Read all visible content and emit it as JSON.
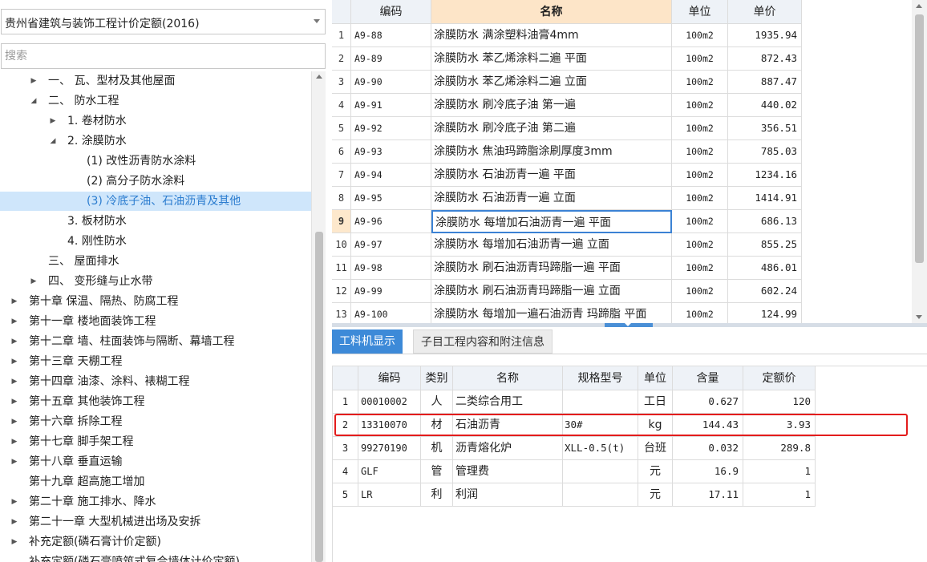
{
  "left_panel": {
    "quota_library": "贵州省建筑与装饰工程计价定额(2016)",
    "search_placeholder": "搜索",
    "tree": [
      {
        "label": "一、 瓦、型材及其他屋面",
        "toggle": "▶",
        "level": 3,
        "selected": false
      },
      {
        "label": "二、 防水工程",
        "toggle": "◢",
        "level": 3,
        "selected": false
      },
      {
        "label": "1. 卷材防水",
        "toggle": "▶",
        "level": 4,
        "selected": false
      },
      {
        "label": "2. 涂膜防水",
        "toggle": "◢",
        "level": 4,
        "selected": false
      },
      {
        "label": "(1) 改性沥青防水涂料",
        "toggle": "",
        "level": 5,
        "selected": false
      },
      {
        "label": "(2) 高分子防水涂料",
        "toggle": "",
        "level": 5,
        "selected": false
      },
      {
        "label": "(3) 冷底子油、石油沥青及其他",
        "toggle": "",
        "level": 5,
        "selected": true
      },
      {
        "label": "3. 板材防水",
        "toggle": "",
        "level": 4,
        "selected": false
      },
      {
        "label": "4. 刚性防水",
        "toggle": "",
        "level": 4,
        "selected": false
      },
      {
        "label": "三、 屋面排水",
        "toggle": "",
        "level": 3,
        "selected": false
      },
      {
        "label": "四、 变形缝与止水带",
        "toggle": "▶",
        "level": 3,
        "selected": false
      },
      {
        "label": "第十章 保温、隔热、防腐工程",
        "toggle": "▶",
        "level": 1,
        "selected": false
      },
      {
        "label": "第十一章 楼地面装饰工程",
        "toggle": "▶",
        "level": 1,
        "selected": false
      },
      {
        "label": "第十二章 墙、柱面装饰与隔断、幕墙工程",
        "toggle": "▶",
        "level": 1,
        "selected": false
      },
      {
        "label": "第十三章 天棚工程",
        "toggle": "▶",
        "level": 1,
        "selected": false
      },
      {
        "label": "第十四章 油漆、涂料、裱糊工程",
        "toggle": "▶",
        "level": 1,
        "selected": false
      },
      {
        "label": "第十五章 其他装饰工程",
        "toggle": "▶",
        "level": 1,
        "selected": false
      },
      {
        "label": "第十六章 拆除工程",
        "toggle": "▶",
        "level": 1,
        "selected": false
      },
      {
        "label": "第十七章 脚手架工程",
        "toggle": "▶",
        "level": 1,
        "selected": false
      },
      {
        "label": "第十八章 垂直运输",
        "toggle": "▶",
        "level": 1,
        "selected": false
      },
      {
        "label": "第十九章 超高施工增加",
        "toggle": "",
        "level": 1,
        "selected": false
      },
      {
        "label": "第二十章 施工排水、降水",
        "toggle": "▶",
        "level": 1,
        "selected": false
      },
      {
        "label": "第二十一章 大型机械进出场及安拆",
        "toggle": "▶",
        "level": 1,
        "selected": false
      },
      {
        "label": "补充定额(磷石膏计价定额)",
        "toggle": "▶",
        "level": 1,
        "selected": false
      },
      {
        "label": "补充定额(磷石膏喷筑式复合墙体计价定额)",
        "toggle": "",
        "level": 1,
        "selected": false
      }
    ]
  },
  "quota_grid": {
    "headers": {
      "code": "编码",
      "name": "名称",
      "unit": "单位",
      "price": "单价"
    },
    "active_row": 9,
    "rows": [
      {
        "no": "1",
        "code": "A9-88",
        "name": "涂膜防水 满涂塑料油膏4mm",
        "unit": "100m2",
        "price": "1935.94"
      },
      {
        "no": "2",
        "code": "A9-89",
        "name": "涂膜防水 苯乙烯涂料二遍 平面",
        "unit": "100m2",
        "price": "872.43"
      },
      {
        "no": "3",
        "code": "A9-90",
        "name": "涂膜防水 苯乙烯涂料二遍 立面",
        "unit": "100m2",
        "price": "887.47"
      },
      {
        "no": "4",
        "code": "A9-91",
        "name": "涂膜防水 刷冷底子油 第一遍",
        "unit": "100m2",
        "price": "440.02"
      },
      {
        "no": "5",
        "code": "A9-92",
        "name": "涂膜防水 刷冷底子油 第二遍",
        "unit": "100m2",
        "price": "356.51"
      },
      {
        "no": "6",
        "code": "A9-93",
        "name": "涂膜防水 焦油玛蹄脂涂刷厚度3mm",
        "unit": "100m2",
        "price": "785.03"
      },
      {
        "no": "7",
        "code": "A9-94",
        "name": "涂膜防水 石油沥青一遍 平面",
        "unit": "100m2",
        "price": "1234.16"
      },
      {
        "no": "8",
        "code": "A9-95",
        "name": "涂膜防水 石油沥青一遍 立面",
        "unit": "100m2",
        "price": "1414.91"
      },
      {
        "no": "9",
        "code": "A9-96",
        "name": "涂膜防水 每增加石油沥青一遍 平面",
        "unit": "100m2",
        "price": "686.13"
      },
      {
        "no": "10",
        "code": "A9-97",
        "name": "涂膜防水 每增加石油沥青一遍 立面",
        "unit": "100m2",
        "price": "855.25"
      },
      {
        "no": "11",
        "code": "A9-98",
        "name": "涂膜防水 刷石油沥青玛蹄脂一遍 平面",
        "unit": "100m2",
        "price": "486.01"
      },
      {
        "no": "12",
        "code": "A9-99",
        "name": "涂膜防水 刷石油沥青玛蹄脂一遍 立面",
        "unit": "100m2",
        "price": "602.24"
      },
      {
        "no": "13",
        "code": "A9-100",
        "name": "涂膜防水 每增加一遍石油沥青 玛蹄脂 平面",
        "unit": "100m2",
        "price": "124.99"
      }
    ]
  },
  "detail_panel": {
    "tabs": [
      {
        "label": "工料机显示",
        "active": true
      },
      {
        "label": "子目工程内容和附注信息",
        "active": false
      }
    ],
    "headers": {
      "code": "编码",
      "category": "类别",
      "name": "名称",
      "spec": "规格型号",
      "unit": "单位",
      "qty": "含量",
      "price": "定额价"
    },
    "rows": [
      {
        "no": "1",
        "code": "00010002",
        "category": "人",
        "name": "二类综合用工",
        "spec": "",
        "unit": "工日",
        "qty": "0.627",
        "price": "120"
      },
      {
        "no": "2",
        "code": "13310070",
        "category": "材",
        "name": "石油沥青",
        "spec": "30#",
        "unit": "kg",
        "qty": "144.43",
        "price": "3.93"
      },
      {
        "no": "3",
        "code": "99270190",
        "category": "机",
        "name": "沥青熔化炉",
        "spec": "XLL-0.5(t)",
        "unit": "台班",
        "qty": "0.032",
        "price": "289.8"
      },
      {
        "no": "4",
        "code": "GLF",
        "category": "管",
        "name": "管理费",
        "spec": "",
        "unit": "元",
        "qty": "16.9",
        "price": "1"
      },
      {
        "no": "5",
        "code": "LR",
        "category": "利",
        "name": "利润",
        "spec": "",
        "unit": "元",
        "qty": "17.11",
        "price": "1"
      }
    ]
  },
  "colors": {
    "selected_tree_bg": "#cfe6fb",
    "selected_tree_text": "#2b7ccf",
    "sorted_header_bg": "#fde5c8",
    "active_tab_bg": "#3d8ad8",
    "highlight_border": "#e31c1c"
  }
}
